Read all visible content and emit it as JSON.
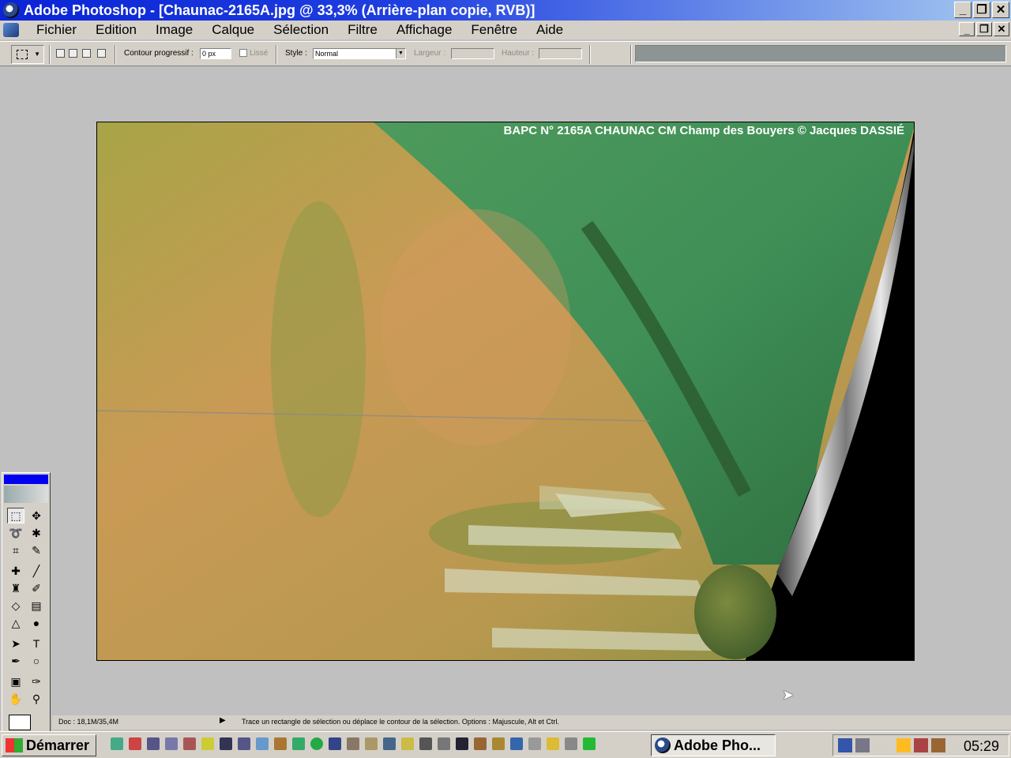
{
  "window": {
    "title": "Adobe Photoshop - [Chaunac-2165A.jpg @ 33,3% (Arrière-plan copie, RVB)]",
    "buttons": [
      "_",
      "❐",
      "✕"
    ],
    "doc_buttons": [
      "_",
      "❐",
      "✕"
    ]
  },
  "menu": {
    "items": [
      "Fichier",
      "Edition",
      "Image",
      "Calque",
      "Sélection",
      "Filtre",
      "Affichage",
      "Fenêtre",
      "Aide"
    ]
  },
  "options": {
    "feather_label": "Contour progressif :",
    "feather_value": "0 px",
    "antialias_label": "Lissé",
    "style_label": "Style :",
    "style_value": "Normal",
    "width_label": "Largeur :",
    "height_label": "Hauteur :"
  },
  "canvas": {
    "caption": "BAPC N° 2165A  CHAUNAC CM Champ des Bouyers  ©  Jacques DASSIÉ"
  },
  "toolbox": {
    "tools": [
      "rect-marquee",
      "move",
      "lasso",
      "magic-wand",
      "crop",
      "slice",
      "healing",
      "brush",
      "clone-stamp",
      "history-brush",
      "eraser",
      "gradient",
      "blur",
      "dodge",
      "path-select",
      "type",
      "pen",
      "shape",
      "notes",
      "eyedropper",
      "hand",
      "zoom"
    ]
  },
  "status": {
    "doc_size": "Doc : 18,1M/35,4M",
    "hint": "Trace un rectangle de sélection ou déplace le contour de la sélection. Options : Majuscule, Alt et Ctrl."
  },
  "taskbar": {
    "start_label": "Démarrer",
    "task_label": "Adobe Pho...",
    "clock": "05:29"
  },
  "colors": {
    "titlebar_start": "#0a24d6",
    "titlebar_end": "#a6caf0",
    "chrome": "#d4d0c8",
    "workspace": "#c0c0c0"
  }
}
